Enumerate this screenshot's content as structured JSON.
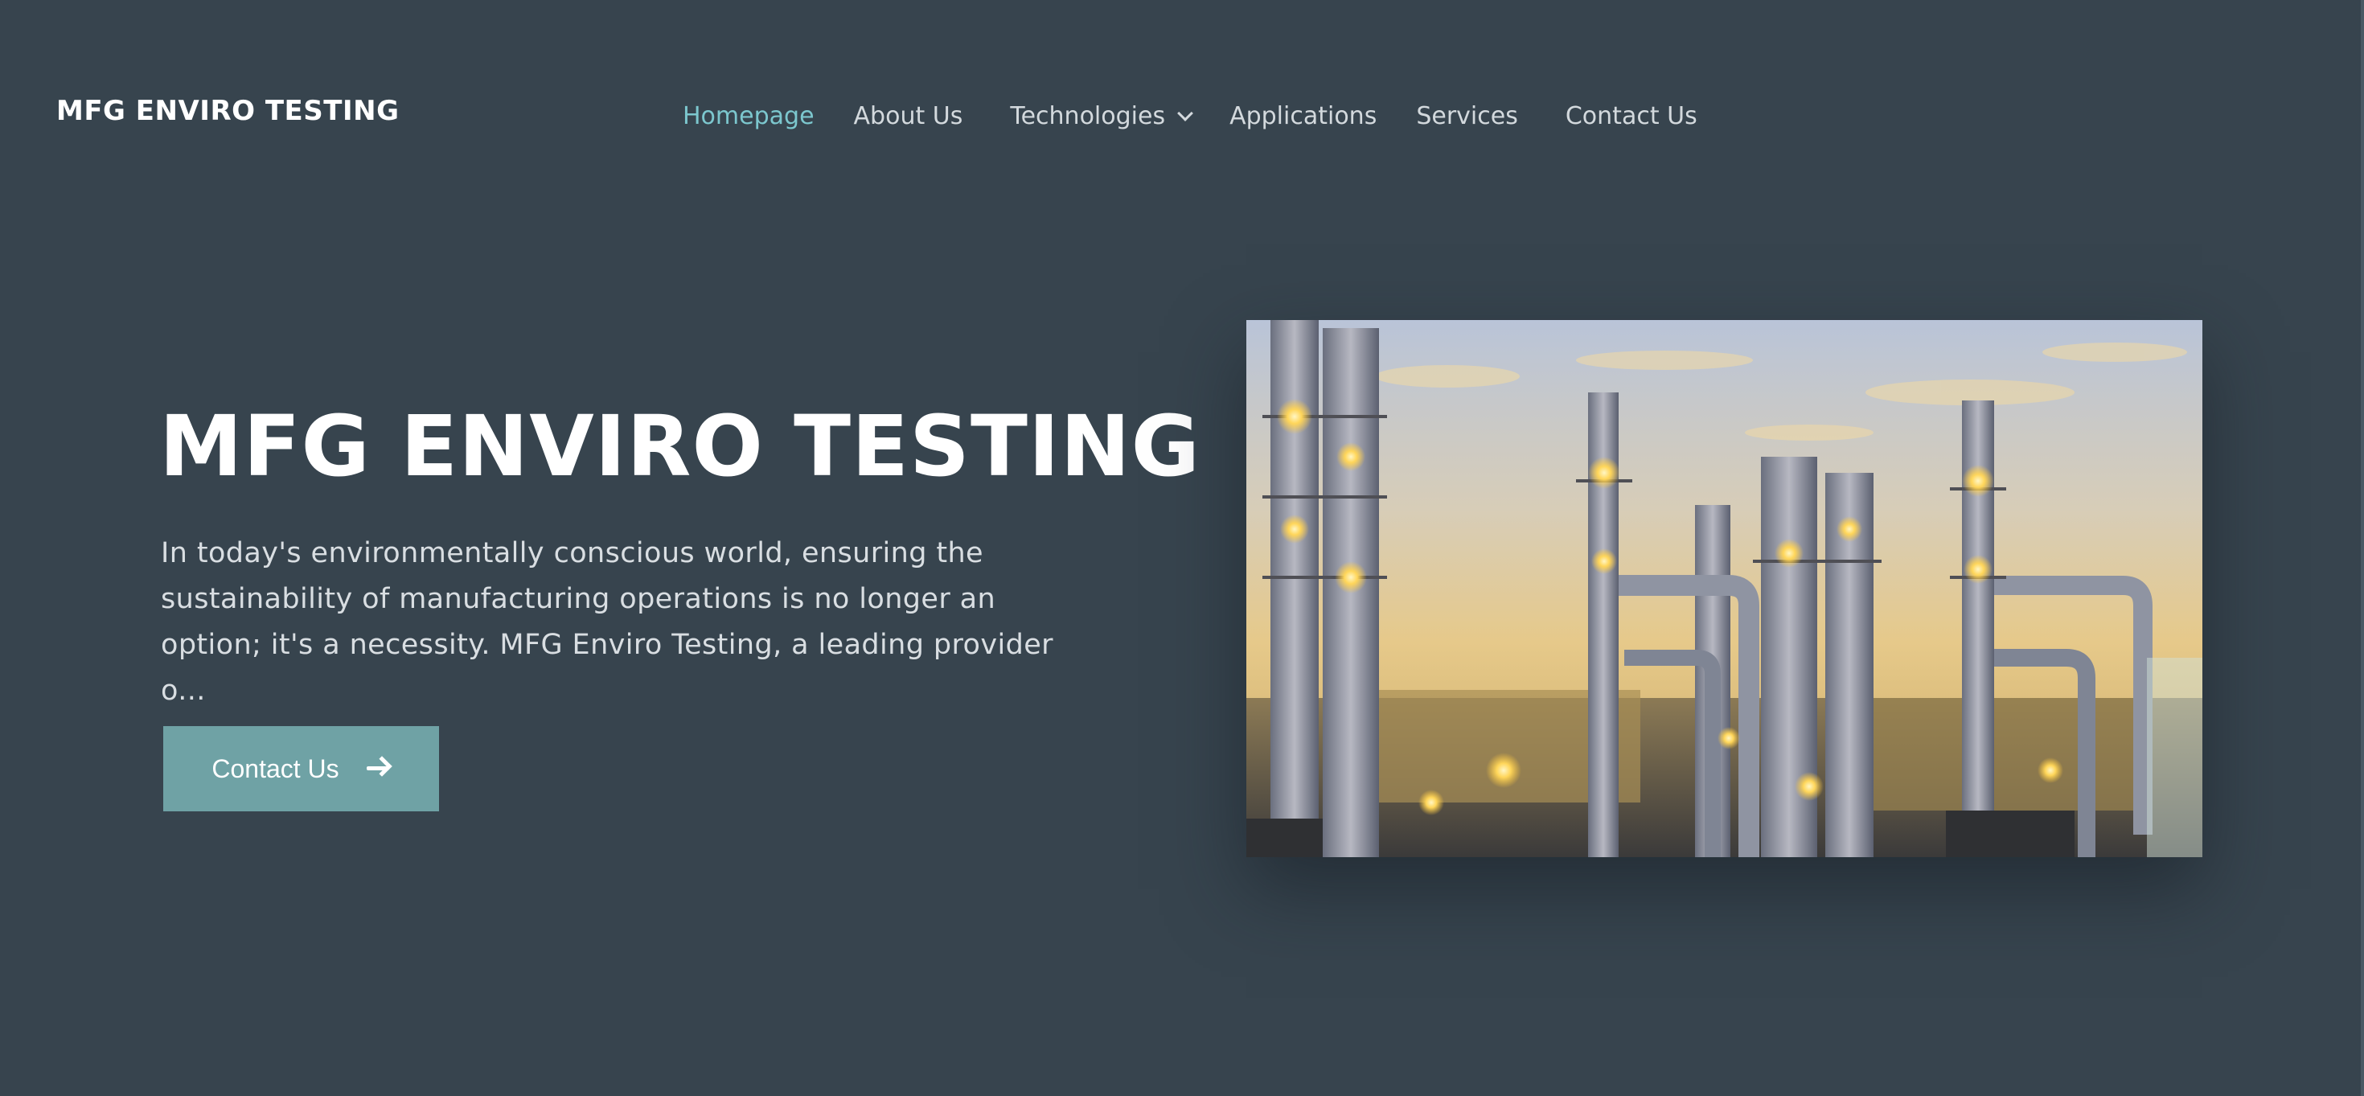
{
  "header": {
    "logo": "MFG ENVIRO TESTING",
    "nav": [
      {
        "label": "Homepage",
        "active": true
      },
      {
        "label": "About Us"
      },
      {
        "label": "Technologies",
        "has_dropdown": true
      },
      {
        "label": "Applications"
      },
      {
        "label": "Services"
      },
      {
        "label": "Contact Us"
      }
    ]
  },
  "hero": {
    "title": "MFG ENVIRO TESTING",
    "description": "In today's environmentally conscious world, ensuring the sustainability of manufacturing operations is no longer an option; it's a necessity. MFG Enviro Testing, a leading provider o...",
    "cta_label": "Contact Us",
    "cta_icon": "arrow-right-icon",
    "image_subject": "refinery-at-dusk-image"
  },
  "colors": {
    "background": "#37444e",
    "accent": "#7cc7ce",
    "button": "#6fa2a5",
    "text": "#d9dee2"
  }
}
